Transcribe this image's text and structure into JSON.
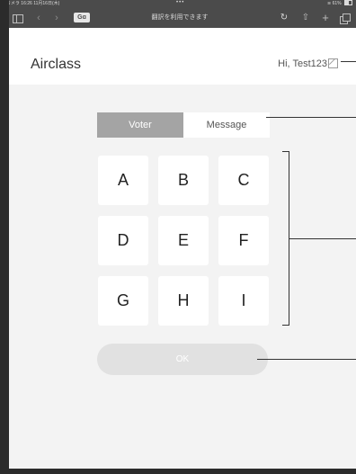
{
  "status_bar": {
    "left_text": "◂ カメラ  16:26  11月16日(木)",
    "center_dots": "•••",
    "right_text": "61%"
  },
  "browser_toolbar": {
    "title": "翻訳を利用できます",
    "translate_label": "Gɑ",
    "back_icon": "chevron-left-icon",
    "forward_icon": "chevron-right-icon",
    "reload_icon": "reload-icon",
    "share_icon": "share-icon",
    "new_tab_icon": "plus-icon",
    "tabs_icon": "tabs-icon"
  },
  "header": {
    "app_title": "Airclass",
    "greeting": "Hi, Test123"
  },
  "tabs": [
    {
      "label": "Voter",
      "active": true
    },
    {
      "label": "Message",
      "active": false
    }
  ],
  "keypad": {
    "keys": [
      "A",
      "B",
      "C",
      "D",
      "E",
      "F",
      "G",
      "H",
      "I"
    ]
  },
  "ok_button": {
    "label": "OK"
  },
  "colors": {
    "chrome_bar": "#4b4b4b",
    "active_tab": "#a4a4a4",
    "content_bg": "#f3f3f3",
    "ok_disabled": "#e1e1e1"
  }
}
